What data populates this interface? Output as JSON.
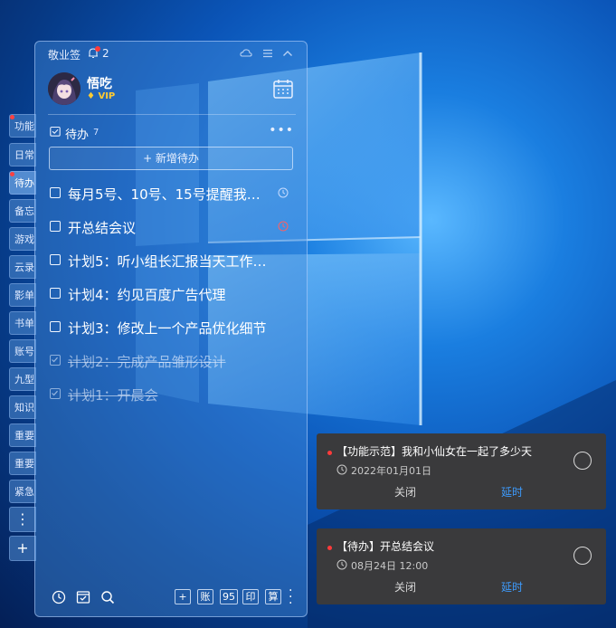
{
  "app": {
    "title": "敬业签",
    "notification_count": "2"
  },
  "user": {
    "name": "悟吃",
    "badge": "VIP"
  },
  "side_tabs": [
    "功能",
    "日常",
    "待办",
    "备忘",
    "游戏",
    "云录",
    "影单",
    "书单",
    "账号",
    "九型",
    "知识",
    "重要",
    "重要",
    "紧急"
  ],
  "todo": {
    "title": "待办",
    "count": "7",
    "add_label": "+ 新增待办",
    "items": [
      {
        "text": "每月5号、10号、15号提醒我…",
        "done": false
      },
      {
        "text": "开总结会议",
        "done": false
      },
      {
        "text": "计划5：听小组长汇报当天工作…",
        "done": false
      },
      {
        "text": "计划4：约见百度广告代理",
        "done": false
      },
      {
        "text": "计划3：修改上一个产品优化细节",
        "done": false
      },
      {
        "text": "计划2：完成产品雏形设计",
        "done": true
      },
      {
        "text": "计划1：开晨会",
        "done": true
      }
    ]
  },
  "bottom_bar": {
    "buttons": [
      "+",
      "账",
      "95",
      "印",
      "算"
    ]
  },
  "notifications": [
    {
      "title": "【功能示范】我和小仙女在一起了多少天",
      "time": "2022年01月01日",
      "close": "关闭",
      "delay": "延时"
    },
    {
      "title": "【待办】开总结会议",
      "time": "08月24日  12:00",
      "close": "关闭",
      "delay": "延时"
    }
  ],
  "colors": {
    "accent_blue": "#3d9cff",
    "alert_red": "#ff3b3b",
    "vip_gold": "#ffcc33"
  }
}
